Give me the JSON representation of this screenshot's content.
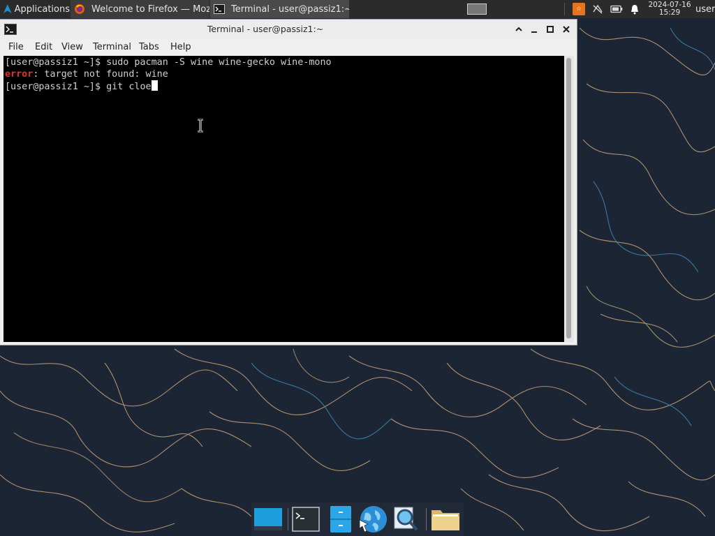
{
  "top_panel": {
    "applications_label": "Applications",
    "tasks": [
      {
        "label": "Welcome to Firefox — Mozil...",
        "icon": "firefox-icon"
      },
      {
        "label": "Terminal - user@passiz1:~",
        "icon": "terminal-icon"
      }
    ],
    "tray": {
      "orange_label": "☆",
      "network_icon": "network-disconnected-icon",
      "battery_icon": "battery-icon",
      "notification_icon": "bell-icon"
    },
    "clock": {
      "date": "2024-07-16",
      "time": "15:29"
    },
    "user": "user"
  },
  "window": {
    "title": "Terminal - user@passiz1:~",
    "menu": [
      "File",
      "Edit",
      "View",
      "Terminal",
      "Tabs",
      "Help"
    ]
  },
  "terminal": {
    "line1": "[user@passiz1 ~]$ sudo pacman -S wine wine-gecko wine-mono",
    "line2_error": "error",
    "line2_rest": ": target not found: wine",
    "line3": "[user@passiz1 ~]$ git cloe"
  },
  "colors": {
    "terminal_bg": "#000000",
    "terminal_fg": "#cfcfcf",
    "error": "#e03232",
    "panel_bg": "#2b2b2b",
    "wallpaper_bg": "#1d2636"
  },
  "dock": {
    "items": [
      "desktop-icon",
      "terminal-icon",
      "file-cabinet-icon",
      "web-browser-icon",
      "search-icon",
      "folder-icon"
    ]
  }
}
